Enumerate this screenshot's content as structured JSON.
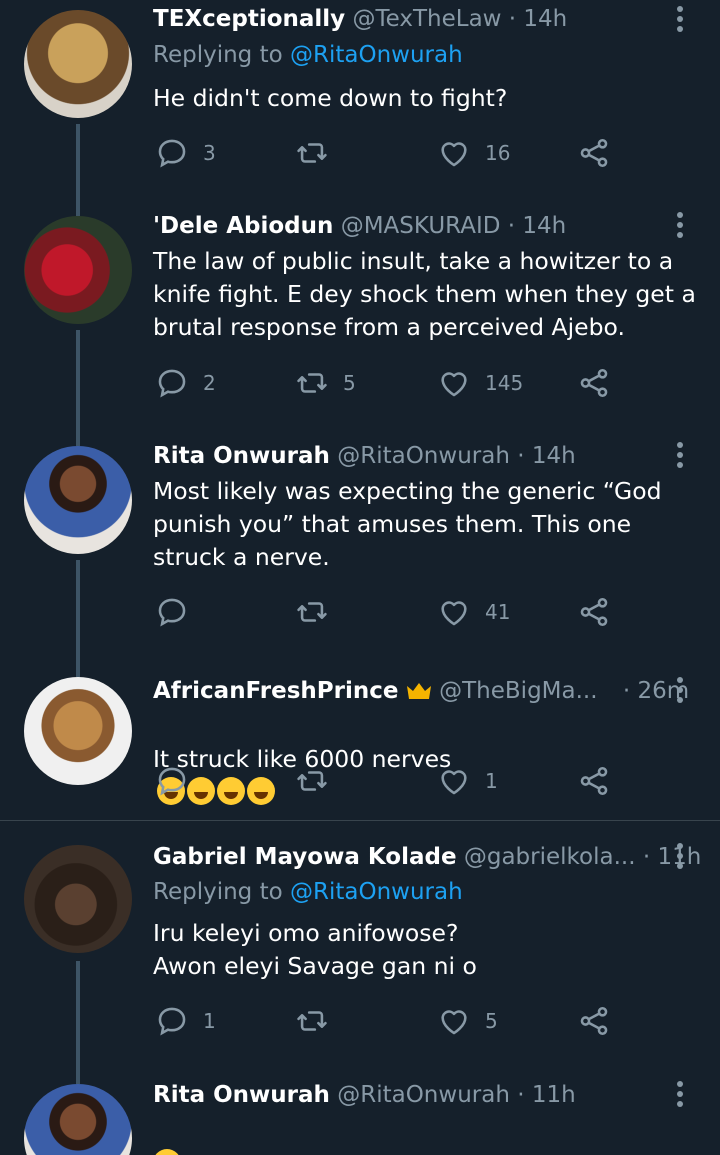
{
  "tweets": [
    {
      "name": "TEXceptionally",
      "handle": "@TexTheLaw",
      "time": "· 14h",
      "replying_prefix": "Replying to ",
      "replying_to": "@RitaOnwurah",
      "text": "He didn't come down to fight?",
      "replies": "3",
      "retweets": "",
      "likes": "16",
      "avatar_colors": [
        "#c9a15b",
        "#6a4a2a"
      ]
    },
    {
      "name": "'Dele Abiodun",
      "handle": "@MASKURAID",
      "time": "· 14h",
      "text": "The law of public insult, take a howitzer to a knife fight. E dey shock them when they get a brutal response from a perceived Ajebo.",
      "replies": "2",
      "retweets": "5",
      "likes": "145",
      "avatar_colors": [
        "#c0182a",
        "#2a3b2a"
      ]
    },
    {
      "name": "Rita Onwurah",
      "handle": "@RitaOnwurah",
      "time": "· 14h",
      "text": "Most likely was expecting the generic “God punish you” that amuses them. This one struck a nerve.",
      "replies": "",
      "retweets": "",
      "likes": "41",
      "avatar_colors": [
        "#e8e4df",
        "#3b5ea8"
      ]
    },
    {
      "name": "AfricanFreshPrince",
      "handle": "@TheBigMa...",
      "time": "· 26m",
      "text": "It struck like 6000 nerves",
      "replies": "",
      "retweets": "",
      "likes": "1",
      "avatar_colors": [
        "#f0f0f0",
        "#c08a4a"
      ]
    },
    {
      "name": "Gabriel Mayowa Kolade",
      "handle": "@gabrielkola...",
      "time": "· 11h",
      "replying_prefix": "Replying to ",
      "replying_to": "@RitaOnwurah",
      "text": "Iru keleyi omo anifowose?\nAwon eleyi Savage gan ni o",
      "replies": "1",
      "retweets": "",
      "likes": "5",
      "avatar_colors": [
        "#2a1f18",
        "#5a4030"
      ]
    },
    {
      "name": "Rita Onwurah",
      "handle": "@RitaOnwurah",
      "time": "· 11h",
      "text": "",
      "avatar_colors": [
        "#e8e4df",
        "#3b5ea8"
      ]
    }
  ],
  "icons": {
    "reply": "reply-icon",
    "retweet": "retweet-icon",
    "like": "heart-icon",
    "share": "share-icon",
    "more": "more-vertical-icon",
    "crown": "crown-emoji",
    "laugh": "tears-of-joy-emoji",
    "sad": "frowning-face-emoji"
  },
  "colors": {
    "background": "#15202b",
    "secondary_text": "#8899a6",
    "mention": "#1da1f2",
    "divider": "#38444d"
  }
}
